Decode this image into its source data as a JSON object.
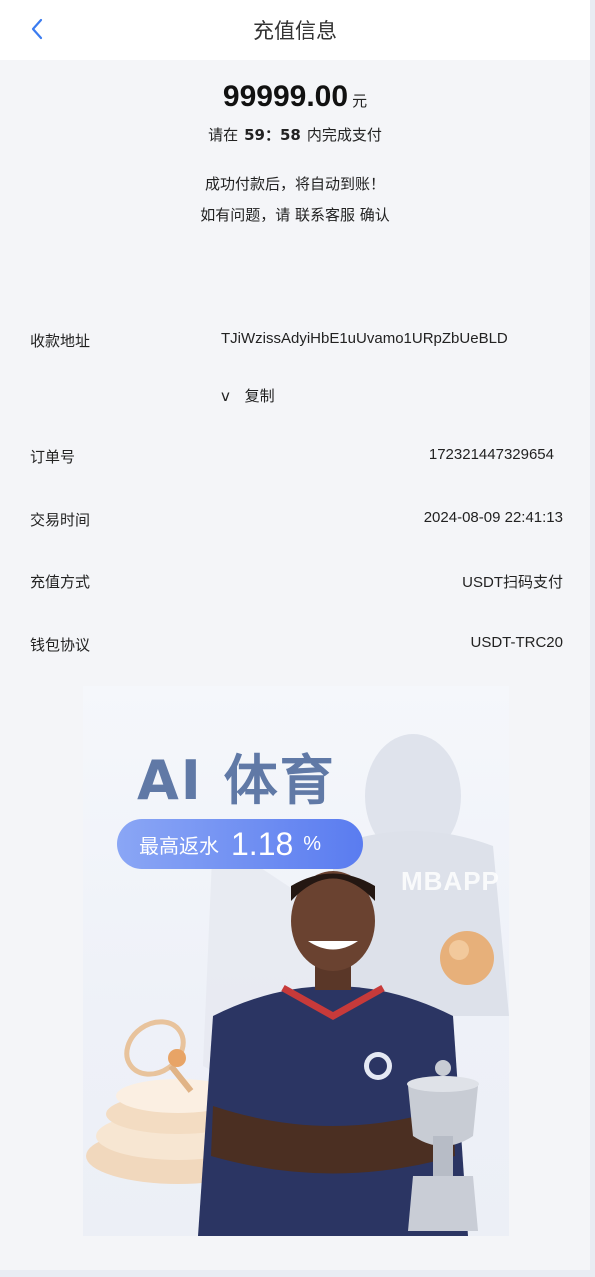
{
  "header": {
    "title": "充值信息",
    "back_icon": "chevron-left-icon"
  },
  "payment": {
    "amount": "99999.00",
    "unit": "元",
    "countdown_prefix": "请在",
    "countdown_minutes": "59",
    "countdown_sep": "：",
    "countdown_seconds": "58",
    "countdown_suffix": "内完成支付",
    "notice_line1": "成功付款后，将自动到账！",
    "notice_line2": "如有问题，请 联系客服 确认"
  },
  "details": {
    "address_label": "收款地址",
    "address_value": "TJiWzissAdyiHbE1uUvamo1URpZbUeBLD",
    "address_tail": "v",
    "copy_label": "复制",
    "order_label": "订单号",
    "order_value": "172321447329654",
    "time_label": "交易时间",
    "time_value": "2024-08-09 22:41:13",
    "method_label": "充值方式",
    "method_value": "USDT扫码支付",
    "protocol_label": "钱包协议",
    "protocol_value": "USDT-TRC20"
  },
  "banner": {
    "title": "AI 体育",
    "pill_label": "最高返水",
    "pill_rate": "1.18",
    "pill_pct": "%",
    "jersey_text": "MBAPP"
  },
  "colors": {
    "accent_blue": "#3b7cf0",
    "background": "#f4f5f8",
    "banner_title": "#6079a6"
  }
}
